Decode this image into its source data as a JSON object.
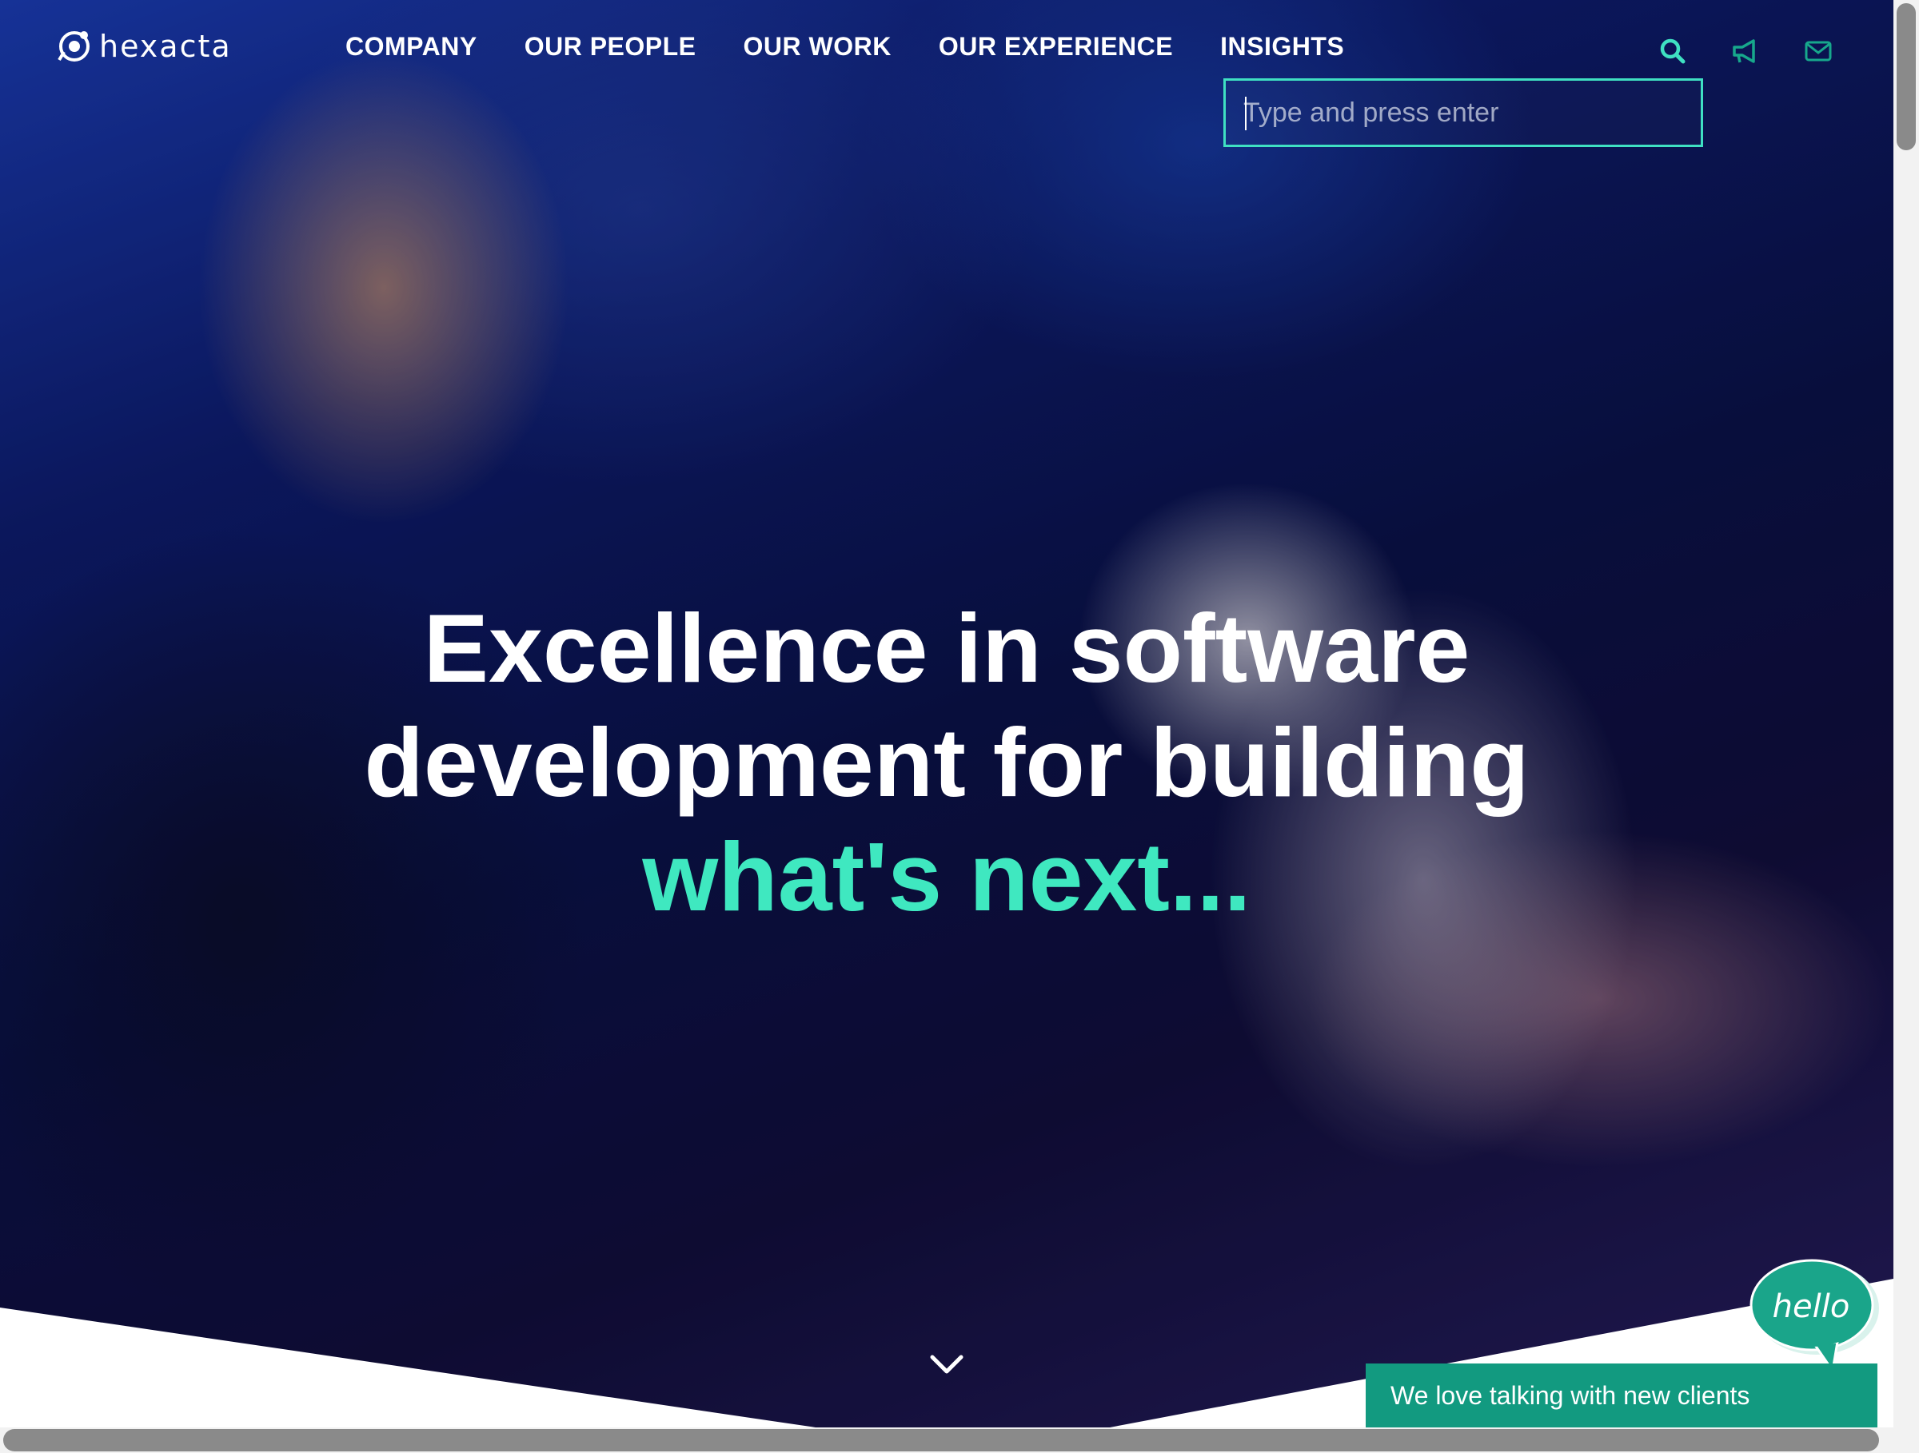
{
  "header": {
    "logo_text": "hexacta",
    "nav": [
      {
        "label": "COMPANY"
      },
      {
        "label": "OUR PEOPLE"
      },
      {
        "label": "OUR WORK"
      },
      {
        "label": "OUR EXPERIENCE"
      },
      {
        "label": "INSIGHTS"
      }
    ],
    "icons": {
      "search": "search-icon",
      "announce": "megaphone-icon",
      "contact": "envelope-icon"
    }
  },
  "search": {
    "placeholder": "Type and press enter",
    "value": ""
  },
  "hero": {
    "line1": "Excellence in software",
    "line2": "development for building",
    "line3": "what's next..."
  },
  "chat": {
    "bubble_text": "hello",
    "bar_text": "We love talking with new clients"
  },
  "colors": {
    "accent": "#3fe8c0",
    "chat_bar": "#129a80",
    "text": "#ffffff"
  }
}
